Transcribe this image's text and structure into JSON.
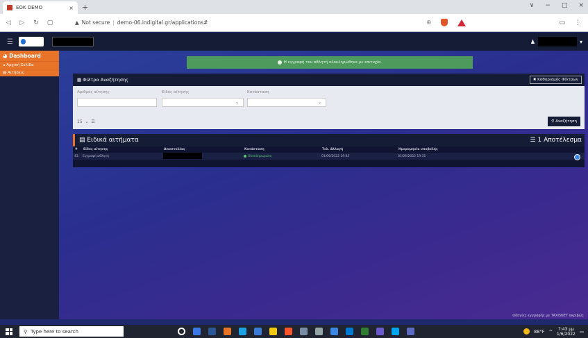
{
  "browser": {
    "tab_title": "ΕΟΚ DEMO",
    "tab_close": "×",
    "new_tab": "+",
    "security_label": "Not secure",
    "url": "demo-06.indigital.gr/applications#",
    "window_controls": [
      "∨",
      "−",
      "□",
      "×"
    ]
  },
  "sidebar": {
    "dashboard_label": "Dashboard",
    "items": [
      {
        "label": "Αρχική Σελίδα"
      },
      {
        "label": "Αιτήσεις"
      }
    ]
  },
  "alert": {
    "message": "Η εγγραφή του αθλητή ολοκληρώθηκε με επιτυχία."
  },
  "filters": {
    "title": "Φίλτρα Αναζήτησης",
    "clear_button": "Καθαρισμός Φίλτρων",
    "fields": [
      {
        "label": "Αριθμός αίτησης",
        "value": ""
      },
      {
        "label": "Είδος αίτησης",
        "value": ""
      },
      {
        "label": "Κατάσταση",
        "value": ""
      }
    ],
    "page_size": "15",
    "search_button": "Αναζήτηση"
  },
  "results": {
    "title": "Ειδικά αιτήματα",
    "count_label": "1 Αποτέλεσμα",
    "columns": [
      "#",
      "Είδος αίτησης",
      "Αποστολέας",
      "Κατάσταση",
      "Τελ. Αλλαγή",
      "Ημερομηνία υποβολής"
    ],
    "rows": [
      {
        "id": "43",
        "type": "Εγγραφή αθλητή",
        "sender": "",
        "status": "Ολοκληρωμένη",
        "last_change": "01/06/2022 19:43",
        "submitted": "01/06/2022 19:31"
      }
    ]
  },
  "footer": {
    "link": "Οδηγίες εγγραφής με TAXISNET ακριβώς"
  },
  "taskbar": {
    "search_placeholder": "Type here to search",
    "temperature": "88°F",
    "time": "7:43 μμ",
    "date": "1/6/2022",
    "icon_colors": [
      "#ffffff",
      "#3b78e7",
      "#2b5797",
      "#e8742a",
      "#1ba1e2",
      "#3a7bd5",
      "#f2c811",
      "#fb542b",
      "#7a8ca5",
      "#95a5a6",
      "#3c87e3",
      "#0078d4",
      "#2e7d32",
      "#6a5acd",
      "#00a4ef",
      "#5c6bc0"
    ]
  },
  "colors": {
    "accent": "#e8742a",
    "navbar": "#141c36",
    "success": "#4e9a5c"
  }
}
